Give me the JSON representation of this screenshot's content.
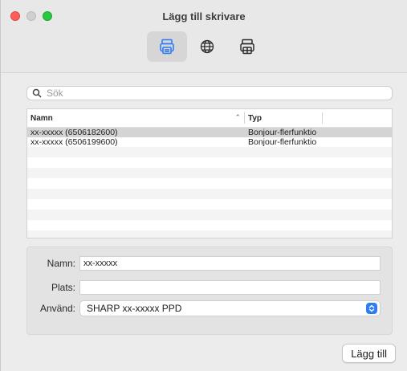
{
  "window": {
    "title": "Lägg till skrivare"
  },
  "toolbar": {
    "items": [
      {
        "icon": "printer-icon",
        "selected": true
      },
      {
        "icon": "globe-icon",
        "selected": false
      },
      {
        "icon": "printer-windows-icon",
        "selected": false
      }
    ]
  },
  "search": {
    "placeholder": "Sök",
    "value": ""
  },
  "table": {
    "columns": [
      "Namn",
      "Typ"
    ],
    "rows": [
      {
        "name": "xx-xxxxx (6506182600)",
        "type": "Bonjour-flerfunktio",
        "selected": true
      },
      {
        "name": "xx-xxxxx (6506199600)",
        "type": "Bonjour-flerfunktio",
        "selected": false
      }
    ]
  },
  "form": {
    "name_label": "Namn:",
    "name_value": "xx-xxxxx",
    "location_label": "Plats:",
    "location_value": "",
    "use_label": "Använd:",
    "use_value": "SHARP xx-xxxxx PPD"
  },
  "actions": {
    "add_label": "Lägg till"
  },
  "colors": {
    "accent": "#2f7cf6",
    "close": "#ff5f57",
    "zoom": "#28c840"
  }
}
